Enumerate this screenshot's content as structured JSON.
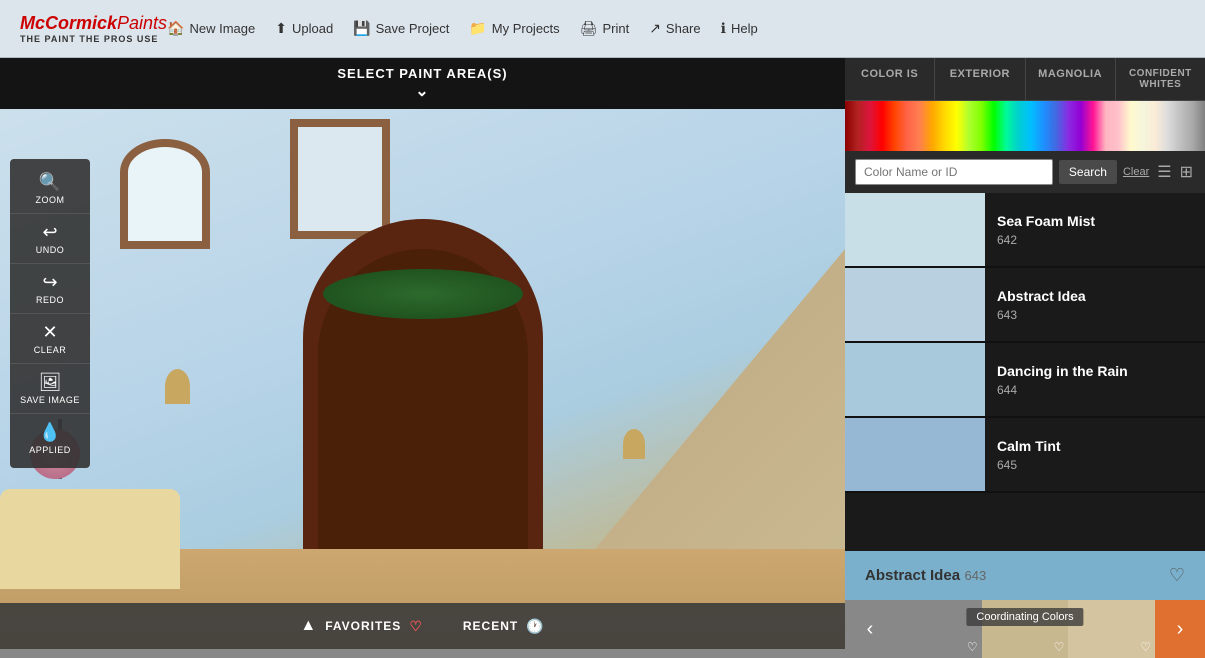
{
  "header": {
    "logo_line1": "McCormick",
    "logo_line2": "Paints",
    "logo_tagline": "THE PAINT THE PROS USE",
    "nav": [
      {
        "icon": "🏠",
        "label": "New Image",
        "name": "new-image-nav"
      },
      {
        "icon": "⬆",
        "label": "Upload",
        "name": "upload-nav"
      },
      {
        "icon": "💾",
        "label": "Save Project",
        "name": "save-project-nav"
      },
      {
        "icon": "📁",
        "label": "My Projects",
        "name": "my-projects-nav"
      },
      {
        "icon": "🖨",
        "label": "Print",
        "name": "print-nav"
      },
      {
        "icon": "↗",
        "label": "Share",
        "name": "share-nav"
      },
      {
        "icon": "ℹ",
        "label": "Help",
        "name": "help-nav"
      }
    ]
  },
  "paint_area_bar": {
    "title": "SELECT PAINT AREA(S)"
  },
  "tools": [
    {
      "icon": "🔍",
      "label": "ZOOM",
      "name": "zoom-tool"
    },
    {
      "icon": "↩",
      "label": "UNDO",
      "name": "undo-tool"
    },
    {
      "icon": "↪",
      "label": "REDO",
      "name": "redo-tool"
    },
    {
      "icon": "✕",
      "label": "CLEAR",
      "name": "clear-tool"
    },
    {
      "icon": "🖼",
      "label": "SAVE IMAGE",
      "name": "save-image-tool"
    },
    {
      "icon": "💧",
      "label": "APPLIED",
      "name": "applied-tool"
    }
  ],
  "favorites_bar": {
    "favorites_label": "FAVORITES",
    "recent_label": "RECENT"
  },
  "right_panel": {
    "tabs": [
      {
        "label": "COLOR IS",
        "active": false,
        "name": "color-is-tab"
      },
      {
        "label": "EXTERIOR",
        "active": false,
        "name": "exterior-tab"
      },
      {
        "label": "MAGNOLIA",
        "active": false,
        "name": "magnolia-tab"
      },
      {
        "label": "CONFIDENT WHITES",
        "active": false,
        "name": "confident-whites-tab"
      }
    ],
    "search": {
      "placeholder": "Color Name or ID",
      "button_label": "Search",
      "clear_label": "Clear"
    },
    "colors": [
      {
        "name": "Sea Foam Mist",
        "number": "642",
        "swatch": "#c8dfe8",
        "name_key": "color-sea-foam-mist"
      },
      {
        "name": "Abstract Idea",
        "number": "643",
        "swatch": "#b8d0e0",
        "name_key": "color-abstract-idea"
      },
      {
        "name": "Dancing in the Rain",
        "number": "644",
        "swatch": "#a8c8dc",
        "name_key": "color-dancing-in-rain"
      },
      {
        "name": "Calm Tint",
        "number": "645",
        "swatch": "#96b8d4",
        "name_key": "color-calm-tint"
      }
    ],
    "selected_color": {
      "name": "Abstract Idea",
      "number": "643",
      "bg": "#7ab0cc"
    },
    "coordinating": {
      "label": "Coordinating Colors",
      "swatches": [
        {
          "color": "#888888"
        },
        {
          "color": "#c8b890"
        },
        {
          "color": "#d4c4a0"
        }
      ]
    }
  }
}
